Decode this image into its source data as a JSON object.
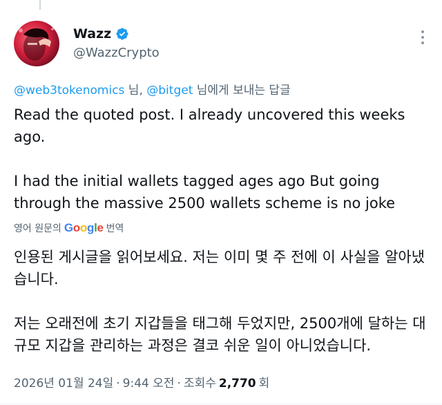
{
  "author": {
    "display_name": "Wazz",
    "handle": "@WazzCrypto",
    "verified_color": "#1d9bf0"
  },
  "reply_to": {
    "mention_1": "@web3tokenomics",
    "sep_1": " 님, ",
    "mention_2": "@bitget",
    "suffix": " 님에게 보내는 답글"
  },
  "tweet": {
    "paragraph_1": "Read the quoted post. I already uncovered this weeks ago.",
    "paragraph_2": "I had the initial wallets tagged ages ago But going through the massive 2500 wallets scheme is no joke"
  },
  "translation": {
    "prefix": "영어 원문의",
    "provider": "Google",
    "suffix": "번역",
    "paragraph_1": "인용된 게시글을 읽어보세요. 저는 이미 몇 주 전에 이 사실을 알아냈습니다.",
    "paragraph_2": "저는 오래전에 초기 지갑들을 태그해 두었지만, 2500개에 달하는 대규모 지갑을 관리하는 과정은 결코 쉬운 일이 아니었습니다."
  },
  "meta": {
    "date": "2026년 01월 24일",
    "time": "9:44 오전",
    "views_label": "조회수",
    "views_count": "2,770",
    "views_unit": "회"
  },
  "colors": {
    "accent": "#1d9bf0",
    "text_primary": "#0f1419",
    "text_secondary": "#536471"
  },
  "icons": {
    "verified": "verified-badge-icon",
    "more": "more-options-icon"
  }
}
